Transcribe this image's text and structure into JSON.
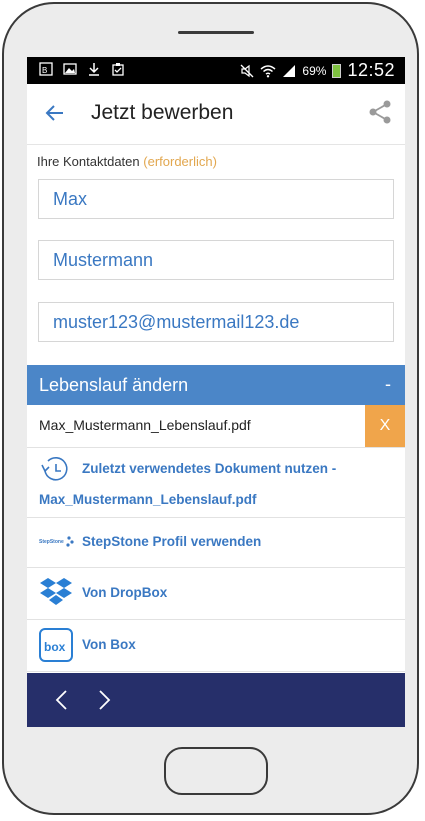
{
  "status_bar": {
    "battery_percent": "69%",
    "time": "12:52",
    "left_icons": [
      "bx-icon",
      "image-icon",
      "download-icon",
      "clipboard-icon"
    ],
    "right_icons": [
      "mute-icon",
      "wifi-icon",
      "signal-icon",
      "battery-icon"
    ]
  },
  "app_bar": {
    "title": "Jetzt bewerben",
    "back_icon": "arrow-left-icon",
    "share_icon": "share-icon"
  },
  "contact": {
    "label": "Ihre Kontaktdaten",
    "required": "(erforderlich)",
    "first_name": "Max",
    "last_name": "Mustermann",
    "email": "muster123@mustermail123.de"
  },
  "cv_section": {
    "title": "Lebenslauf ändern",
    "toggle": "-",
    "attached_file": "Max_Mustermann_Lebenslauf.pdf",
    "remove_label": "X"
  },
  "options": {
    "recent_line1": "Zuletzt verwendetes Dokument nutzen -",
    "recent_line2": "Max_Mustermann_Lebenslauf.pdf",
    "stepstone": "StepStone Profil verwenden",
    "stepstone_logo_text": "StepStone",
    "dropbox": "Von DropBox",
    "box": "Von Box",
    "box_logo_text": "box"
  },
  "colors": {
    "accent_blue": "#3a78c2",
    "section_blue": "#4b86c8",
    "required_orange": "#e2a74f",
    "remove_orange": "#f0a54b",
    "navbar_navy": "#262f6a"
  }
}
